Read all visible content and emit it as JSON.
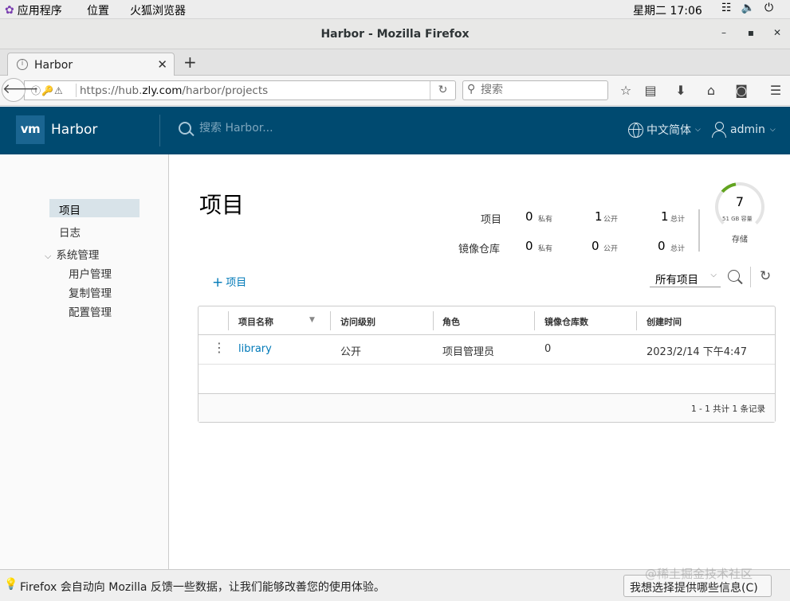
{
  "gnome": {
    "apps_label": "应用程序",
    "places_label": "位置",
    "firefox_label": "火狐浏览器",
    "clock": "星期二 17:06"
  },
  "window": {
    "title": "Harbor - Mozilla Firefox",
    "controls": [
      "–",
      "▪",
      "✕"
    ]
  },
  "browser": {
    "tab_label": "Harbor",
    "url_host_prefix": "https://hub.",
    "url_host_main": "zly.com",
    "url_path": "/harbor/projects",
    "search_placeholder": "搜索"
  },
  "harbor": {
    "logo_text": "vm",
    "brand": "Harbor",
    "search_placeholder": "搜索 Harbor...",
    "language": "中文简体",
    "user": "admin"
  },
  "sidebar": {
    "projects": "项目",
    "logs": "日志",
    "admin_group": "系统管理",
    "users": "用户管理",
    "replication": "复制管理",
    "config": "配置管理"
  },
  "main": {
    "title": "项目",
    "stats": {
      "projects_label": "项目",
      "repos_label": "镜像仓库",
      "projects": {
        "private": "0",
        "public": "1",
        "total": "1"
      },
      "repos": {
        "private": "0",
        "public": "0",
        "total": "0"
      },
      "private_label": "私有",
      "public_label": "公开",
      "total_label": "总计"
    },
    "storage": {
      "value": "7",
      "sub": "51 GB 容量",
      "caption": "存储"
    },
    "add_project": "项目",
    "filter_value": "所有项目"
  },
  "grid": {
    "columns": [
      "项目名称",
      "访问级别",
      "角色",
      "镜像仓库数",
      "创建时间"
    ],
    "rows": [
      {
        "name": "library",
        "access": "公开",
        "role": "项目管理员",
        "repos": "0",
        "created": "2023/2/14 下午4:47"
      }
    ],
    "footer": "1 - 1 共计 1 条记录"
  },
  "notification": {
    "message": "Firefox 会自动向 Mozilla 反馈一些数据，让我们能够改善您的使用体验。",
    "button": "我想选择提供哪些信息(C)"
  },
  "watermark": "@稀土掘金技术社区"
}
